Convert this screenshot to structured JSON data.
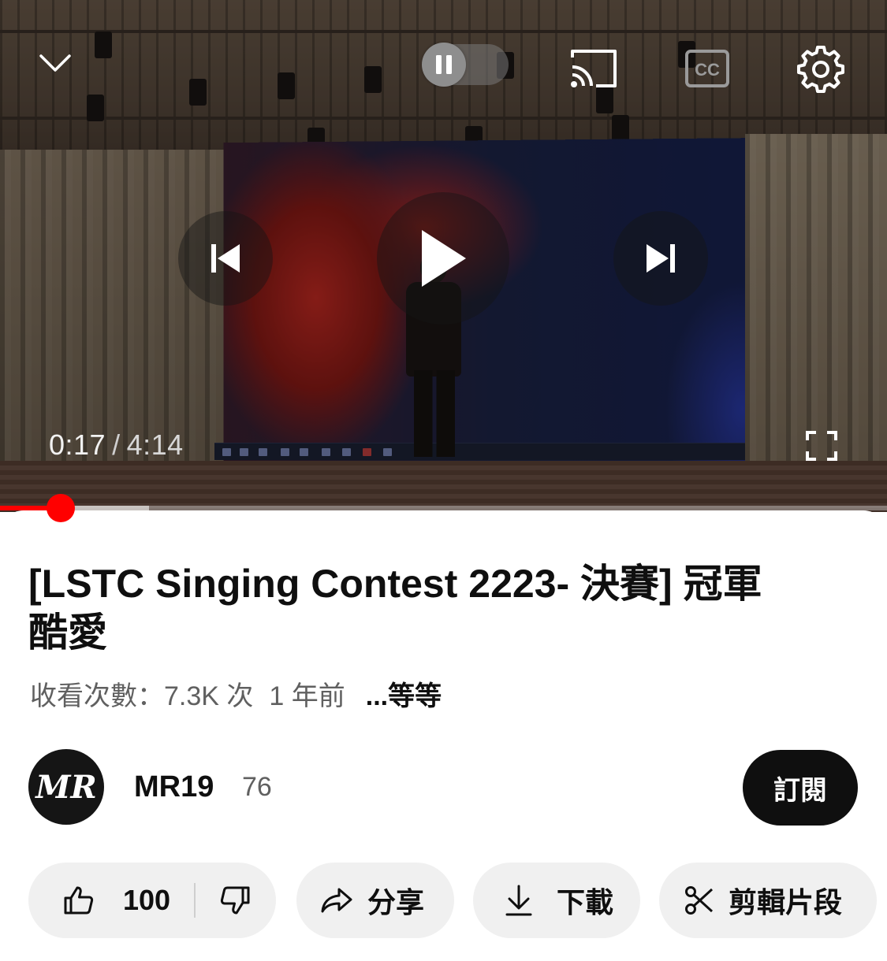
{
  "player": {
    "current_time": "0:17",
    "separator": "/",
    "duration": "4:14",
    "progress_fraction": 0.0669,
    "buffered_fraction": 0.168,
    "cc_label": "CC",
    "accent_color": "#ff0000"
  },
  "icons": {
    "collapse": "chevron-down-icon",
    "pause": "pause-icon",
    "cast": "cast-icon",
    "captions": "captions-icon",
    "settings": "gear-icon",
    "previous": "skip-previous-icon",
    "play": "play-icon",
    "next": "skip-next-icon",
    "fullscreen": "fullscreen-icon",
    "like": "thumbs-up-icon",
    "dislike": "thumbs-down-icon",
    "share": "share-icon",
    "download": "download-icon",
    "clip": "scissors-icon"
  },
  "video": {
    "title_line1": "[LSTC Singing Contest 2223- 決賽] 冠軍",
    "title_line2": "酷愛",
    "views": "收看次數：7.3K 次",
    "age": "1 年前",
    "more": "...等等"
  },
  "channel": {
    "avatar_text": "MR",
    "name": "MR19",
    "subscribers": "76",
    "subscribe_label": "訂閱"
  },
  "actions": {
    "like_count": "100",
    "share_label": "分享",
    "download_label": "下載",
    "clip_label": "剪輯片段"
  }
}
